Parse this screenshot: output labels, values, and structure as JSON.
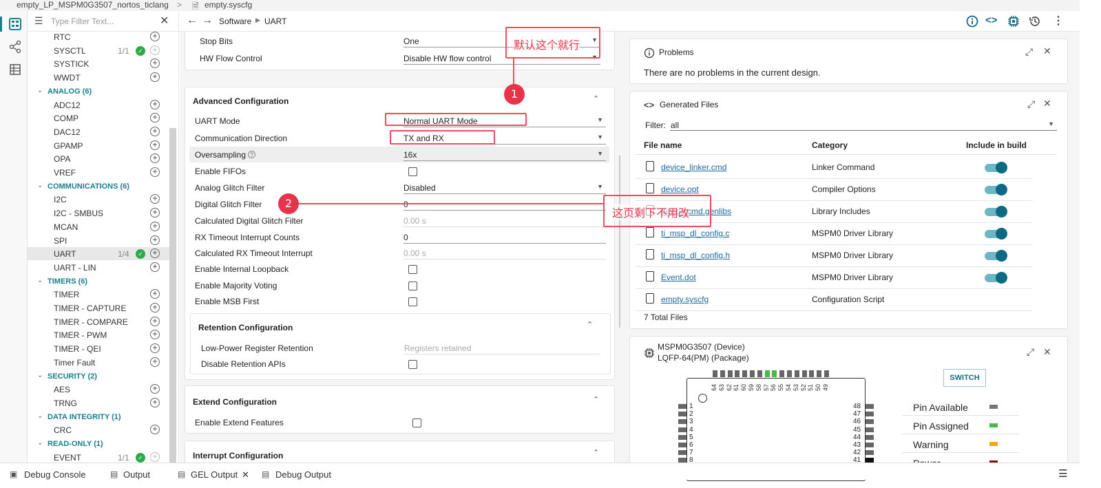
{
  "breadcrumb": {
    "project": "empty_LP_MSPM0G3507_nortos_ticlang",
    "sep": ">",
    "file": "empty.syscfg"
  },
  "filter": {
    "placeholder": "Type Filter Text..."
  },
  "tree": [
    {
      "type": "item",
      "label": "RTC"
    },
    {
      "type": "item",
      "label": "SYSCTL",
      "count": "1/1",
      "ok": true
    },
    {
      "type": "item",
      "label": "SYSTICK"
    },
    {
      "type": "item",
      "label": "WWDT"
    },
    {
      "type": "cat",
      "label": "ANALOG (6)"
    },
    {
      "type": "item",
      "label": "ADC12"
    },
    {
      "type": "item",
      "label": "COMP"
    },
    {
      "type": "item",
      "label": "DAC12"
    },
    {
      "type": "item",
      "label": "GPAMP"
    },
    {
      "type": "item",
      "label": "OPA"
    },
    {
      "type": "item",
      "label": "VREF"
    },
    {
      "type": "cat",
      "label": "COMMUNICATIONS (6)"
    },
    {
      "type": "item",
      "label": "I2C"
    },
    {
      "type": "item",
      "label": "I2C - SMBUS"
    },
    {
      "type": "item",
      "label": "MCAN"
    },
    {
      "type": "item",
      "label": "SPI"
    },
    {
      "type": "item",
      "label": "UART",
      "count": "1/4",
      "ok": true,
      "selected": true
    },
    {
      "type": "item",
      "label": "UART - LIN"
    },
    {
      "type": "cat",
      "label": "TIMERS (6)"
    },
    {
      "type": "item",
      "label": "TIMER"
    },
    {
      "type": "item",
      "label": "TIMER - CAPTURE"
    },
    {
      "type": "item",
      "label": "TIMER - COMPARE"
    },
    {
      "type": "item",
      "label": "TIMER - PWM"
    },
    {
      "type": "item",
      "label": "TIMER - QEI"
    },
    {
      "type": "item",
      "label": "Timer Fault"
    },
    {
      "type": "cat",
      "label": "SECURITY (2)"
    },
    {
      "type": "item",
      "label": "AES"
    },
    {
      "type": "item",
      "label": "TRNG"
    },
    {
      "type": "cat",
      "label": "DATA INTEGRITY (1)"
    },
    {
      "type": "item",
      "label": "CRC"
    },
    {
      "type": "cat",
      "label": "READ-ONLY (1)"
    },
    {
      "type": "item",
      "label": "EVENT",
      "count": "1/1",
      "ok": true
    }
  ],
  "editor": {
    "crumb1": "Software",
    "crumb2": "UART"
  },
  "config": {
    "top": [
      {
        "label": "Stop Bits",
        "value": "One"
      },
      {
        "label": "HW Flow Control",
        "value": "Disable HW flow control"
      }
    ],
    "advanced_title": "Advanced Configuration",
    "advanced": [
      {
        "label": "UART Mode",
        "value": "Normal UART Mode",
        "kind": "dd"
      },
      {
        "label": "Communication Direction",
        "value": "TX and RX",
        "kind": "dd"
      },
      {
        "label": "Oversampling",
        "value": "16x",
        "kind": "dd"
      },
      {
        "label": "Enable FIFOs",
        "kind": "cb"
      },
      {
        "label": "Analog Glitch Filter",
        "value": "Disabled",
        "kind": "dd"
      },
      {
        "label": "Digital Glitch Filter",
        "value": "0",
        "kind": "txt"
      },
      {
        "label": "Calculated Digital Glitch Filter",
        "value": "0.00 s",
        "kind": "ro"
      },
      {
        "label": "RX Timeout Interrupt Counts",
        "value": "0",
        "kind": "txt"
      },
      {
        "label": "Calculated RX Timeout Interrupt",
        "value": "0.00 s",
        "kind": "ro"
      },
      {
        "label": "Enable Internal Loopback",
        "kind": "cb"
      },
      {
        "label": "Enable Majority Voting",
        "kind": "cb"
      },
      {
        "label": "Enable MSB First",
        "kind": "cb"
      }
    ],
    "retention_title": "Retention Configuration",
    "retention": [
      {
        "label": "Low-Power Register Retention",
        "value": "Registers retained",
        "kind": "ro"
      },
      {
        "label": "Disable Retention APIs",
        "kind": "cb"
      }
    ],
    "extend_title": "Extend Configuration",
    "extend_label": "Enable Extend Features",
    "interrupt_title": "Interrupt Configuration"
  },
  "problems": {
    "title": "Problems",
    "message": "There are no problems in the current design."
  },
  "generated": {
    "title": "Generated Files",
    "filter_label": "Filter:",
    "filter_value": "all",
    "headers": [
      "File name",
      "Category",
      "Include in build"
    ],
    "files": [
      {
        "name": "device_linker.cmd",
        "category": "Linker Command",
        "include": true
      },
      {
        "name": "device.opt",
        "category": "Compiler Options",
        "include": true
      },
      {
        "name": "device.cmd.genlibs",
        "category": "Library Includes",
        "include": true
      },
      {
        "name": "ti_msp_dl_config.c",
        "category": "MSPM0 Driver Library",
        "include": true
      },
      {
        "name": "ti_msp_dl_config.h",
        "category": "MSPM0 Driver Library",
        "include": true
      },
      {
        "name": "Event.dot",
        "category": "MSPM0 Driver Library",
        "include": true
      },
      {
        "name": "empty.syscfg",
        "category": "Configuration Script",
        "include": null
      }
    ],
    "total": "7 Total Files"
  },
  "device": {
    "line1": "MSPM0G3507 (Device)",
    "line2": "LQFP-64(PM) (Package)",
    "switch_label": "SWITCH",
    "top_pins": [
      "64",
      "63",
      "62",
      "61",
      "60",
      "59",
      "58",
      "57",
      "56",
      "55",
      "54",
      "53",
      "52",
      "51",
      "50",
      "49"
    ],
    "left_pins": [
      "1",
      "2",
      "3",
      "4",
      "5",
      "6",
      "7",
      "8"
    ],
    "right_pins": [
      "48",
      "47",
      "46",
      "45",
      "44",
      "43",
      "42",
      "41"
    ],
    "legend": [
      {
        "label": "Pin Available",
        "color": "#777777"
      },
      {
        "label": "Pin Assigned",
        "color": "#4cb84c"
      },
      {
        "label": "Warning",
        "color": "#f2a81d"
      },
      {
        "label": "Power",
        "color": "#7a1010"
      }
    ]
  },
  "bottom_tabs": [
    "Debug Console",
    "Output",
    "GEL Output",
    "Debug Output"
  ],
  "annotations": {
    "note1": "默认这个就行",
    "num1": "1",
    "num2": "2",
    "note2": "这页剩下不用改"
  }
}
